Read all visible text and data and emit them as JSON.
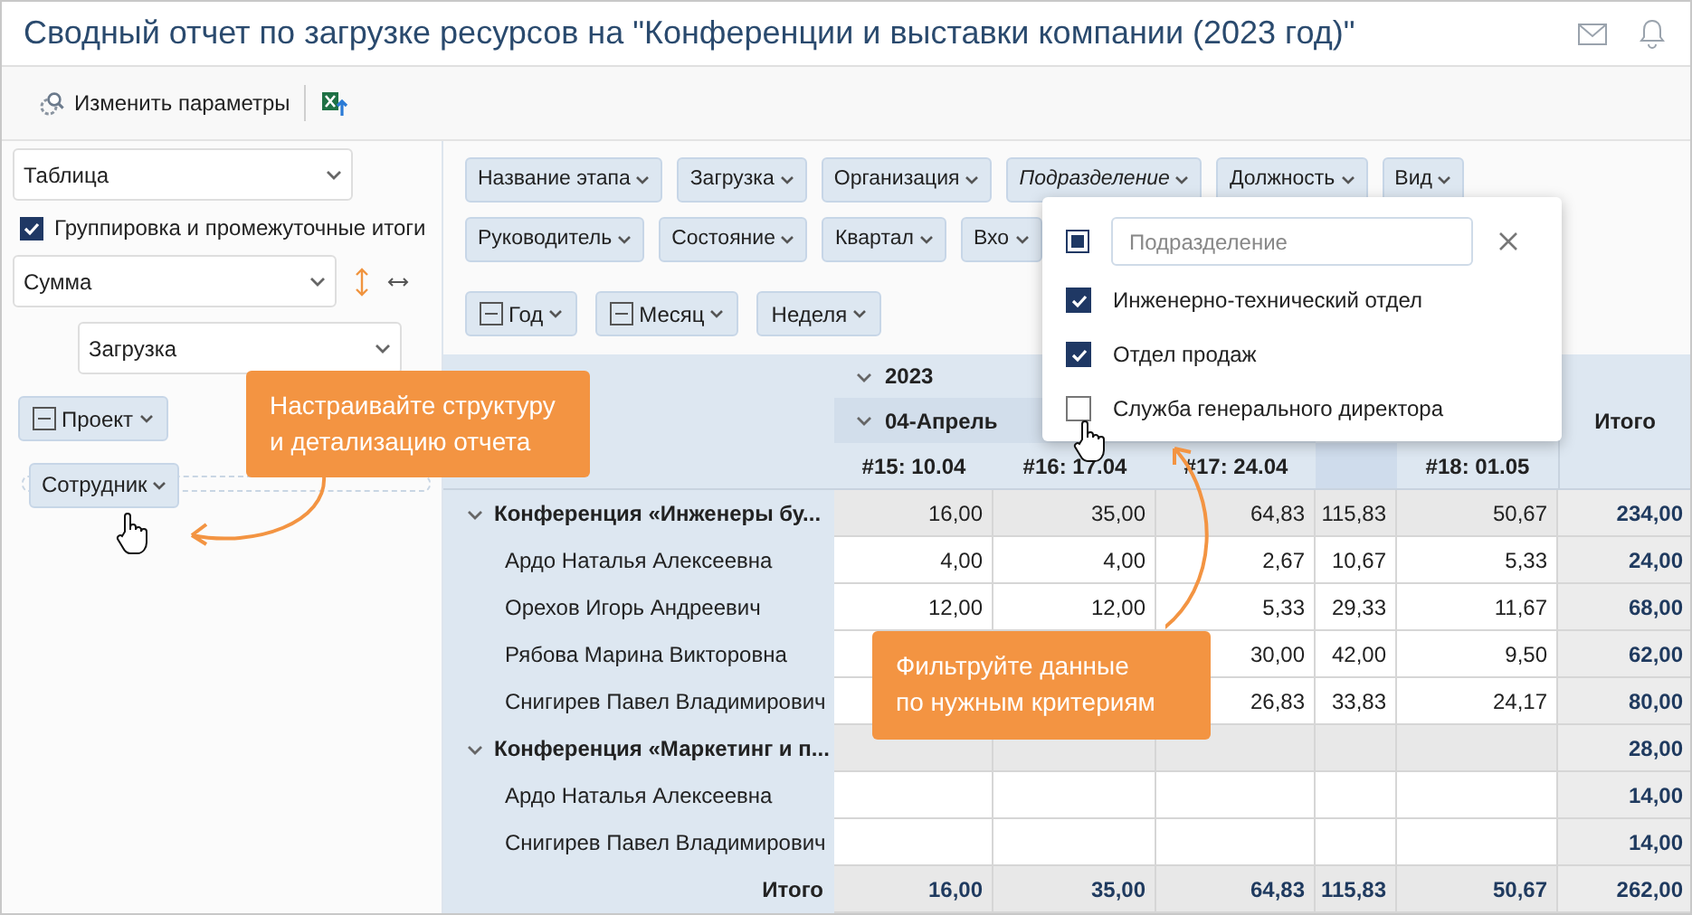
{
  "title": "Сводный отчет по загрузке ресурсов на \"Конференции и выставки компании (2023 год)\"",
  "toolbar": {
    "change_params": "Изменить параметры"
  },
  "left_panel": {
    "view_select": "Таблица",
    "grouping": {
      "label": "Группировка и промежуточные итоги",
      "checked": true
    },
    "aggregate_select": "Сумма",
    "value_select": "Загрузка",
    "row_fields": [
      {
        "label": "Проект",
        "collapsible": true
      }
    ],
    "dragged_field": {
      "label": "Сотрудник"
    }
  },
  "filter_rows": [
    [
      {
        "label": "Название этапа",
        "filtered": false
      },
      {
        "label": "Загрузка",
        "filtered": false
      },
      {
        "label": "Организация",
        "filtered": false
      },
      {
        "label": "Подразделение",
        "filtered": true
      },
      {
        "label": "Должность",
        "filtered": false
      },
      {
        "label": "Вид",
        "filtered": false
      }
    ],
    [
      {
        "label": "Руководитель",
        "filtered": false
      },
      {
        "label": "Состояние",
        "filtered": false
      },
      {
        "label": "Квартал",
        "filtered": false
      },
      {
        "label": "Вхо",
        "filtered": false
      }
    ]
  ],
  "column_fields": [
    {
      "label": "Год",
      "collapsible": true
    },
    {
      "label": "Месяц",
      "collapsible": true
    },
    {
      "label": "Неделя",
      "collapsible": false
    }
  ],
  "filter_popup": {
    "placeholder": "Подразделение",
    "select_all_indeterminate": true,
    "options": [
      {
        "label": "Инженерно-технический отдел",
        "checked": true
      },
      {
        "label": "Отдел продаж",
        "checked": true
      },
      {
        "label": "Служба генерального директора",
        "checked": false
      }
    ]
  },
  "table": {
    "year": "2023",
    "year_expanded": true,
    "month": "04-Апрель",
    "month_expanded": true,
    "weeks": {
      "col_1": "#15: 10.04",
      "col_2": "#16: 17.04",
      "col_3": "#17: 24.04",
      "col_5": "#18: 01.05"
    },
    "total_header": "Итого",
    "rows": [
      {
        "label": "Конференция «Инженеры бу...",
        "expanded": true,
        "values": {
          "col_1": "16,00",
          "col_2": "35,00",
          "col_3": "64,83",
          "col_4": "115,83",
          "col_5": "50,67"
        },
        "total": "234,00",
        "children": [
          {
            "label": "Ардо Наталья Алексеевна",
            "values": {
              "col_1": "4,00",
              "col_2": "4,00",
              "col_3": "2,67",
              "col_4": "10,67",
              "col_5": "5,33"
            },
            "total": "24,00"
          },
          {
            "label": "Орехов Игорь Андреевич",
            "values": {
              "col_1": "12,00",
              "col_2": "12,00",
              "col_3": "5,33",
              "col_4": "29,33",
              "col_5": "11,67"
            },
            "total": "68,00"
          },
          {
            "label": "Рябова Марина Викторовна",
            "values": {
              "col_3": "30,00",
              "col_4": "42,00",
              "col_5": "9,50"
            },
            "total": "62,00"
          },
          {
            "label": "Снигирев Павел Владимирович",
            "values": {
              "col_3": "26,83",
              "col_4": "33,83",
              "col_5": "24,17"
            },
            "total": "80,00"
          }
        ]
      },
      {
        "label": "Конференция «Маркетинг и п...",
        "expanded": true,
        "total": "28,00",
        "children": [
          {
            "label": "Ардо Наталья Алексеевна",
            "total": "14,00"
          },
          {
            "label": "Снигирев Павел Владимирович",
            "total": "14,00"
          }
        ]
      }
    ],
    "grand_total": {
      "label": "Итого",
      "values": {
        "col_1": "16,00",
        "col_2": "35,00",
        "col_3": "64,83",
        "col_4": "115,83",
        "col_5": "50,67"
      },
      "total": "262,00"
    }
  },
  "callouts": [
    "Настраивайте структуру\nи детализацию отчета",
    "Фильтруйте данные\nпо нужным критериям"
  ]
}
